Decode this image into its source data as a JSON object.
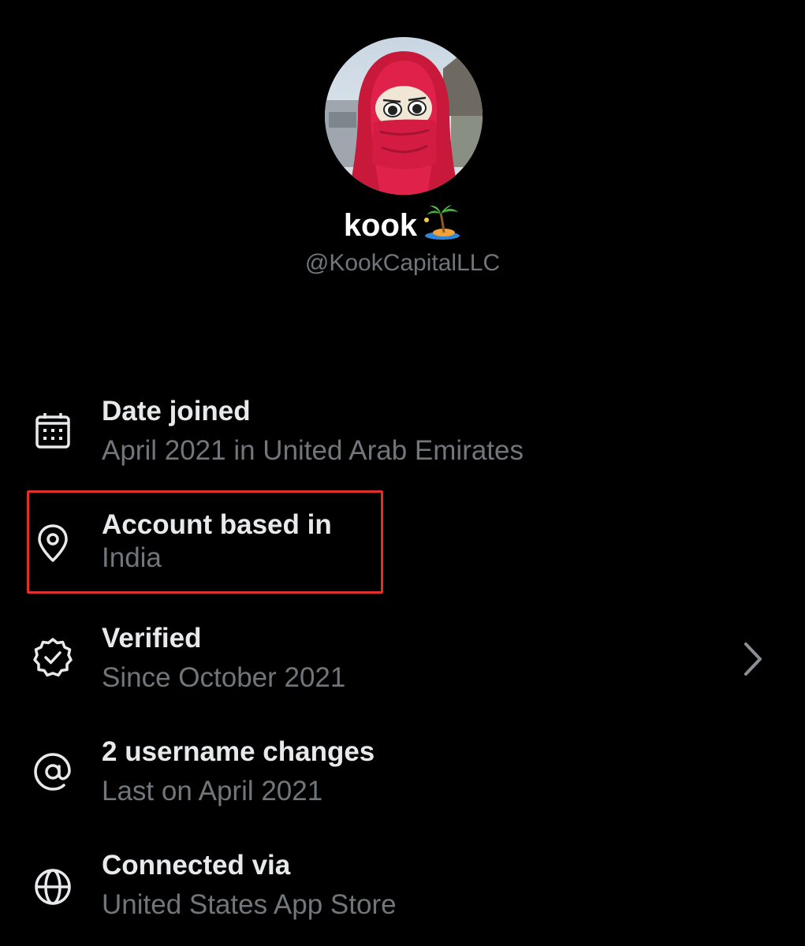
{
  "profile": {
    "display_name": "kook",
    "emoji": "desert-island-emoji",
    "handle": "@KookCapitalLLC"
  },
  "about": {
    "date_joined": {
      "title": "Date joined",
      "value": "April 2021 in United Arab Emirates",
      "icon": "calendar-icon"
    },
    "account_based_in": {
      "title": "Account based in",
      "value": "India",
      "icon": "location-pin-icon",
      "highlighted": true
    },
    "verified": {
      "title": "Verified",
      "value": "Since October 2021",
      "icon": "verified-badge-icon"
    },
    "username_changes": {
      "title": "2 username changes",
      "value": "Last on April 2021",
      "icon": "at-sign-icon"
    },
    "connected_via": {
      "title": "Connected via",
      "value": "United States App Store",
      "icon": "globe-icon"
    }
  },
  "colors": {
    "background": "#000000",
    "primary_text": "#e7e9ea",
    "secondary_text": "#71767b",
    "highlight_border": "#e0302d"
  }
}
